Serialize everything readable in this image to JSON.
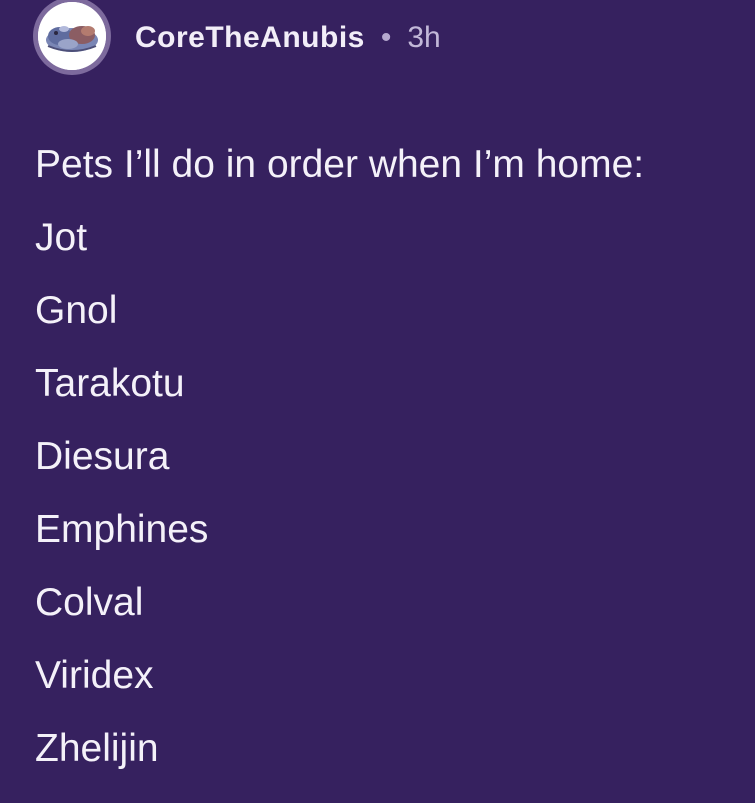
{
  "post": {
    "author": "CoreTheAnubis",
    "separator": "•",
    "timestamp": "3h",
    "intro": "Pets I’ll do in order when I’m home:",
    "pets": [
      "Jot",
      "Gnol",
      "Tarakotu",
      "Diesura",
      "Emphines",
      "Colval",
      "Viridex",
      "Zhelijin"
    ]
  },
  "colors": {
    "background": "#36215f",
    "text": "#f4f1f9",
    "muted": "#c2b8d8",
    "avatar_ring": "#7d6a9d"
  }
}
